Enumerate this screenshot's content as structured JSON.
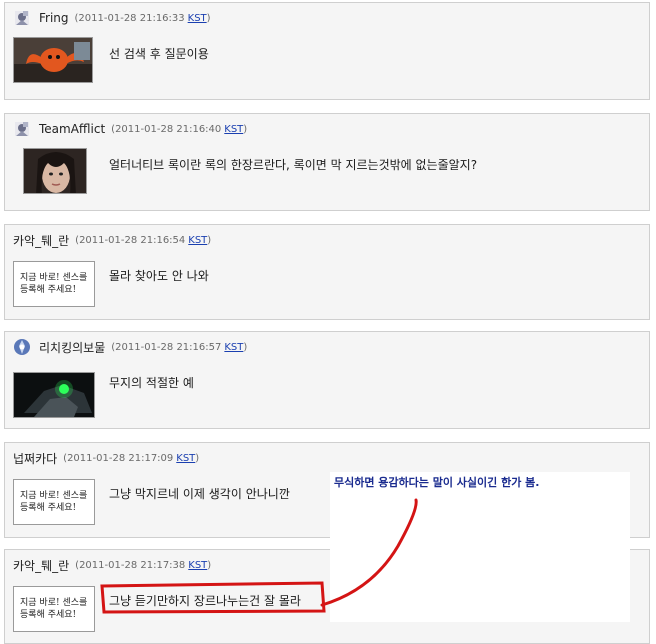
{
  "comments": [
    {
      "name": "Fring",
      "time": "(2011-01-28 21:16:33",
      "tz": "KST",
      "close": ")",
      "text": "선 검색 후 질문이용"
    },
    {
      "name": "TeamAfflict",
      "time": "(2011-01-28 21:16:40",
      "tz": "KST",
      "close": ")",
      "text": "얼터너티브 록이란 록의 한장르란다, 록이면 막 지르는것밖에 없는줄알지?"
    },
    {
      "name": "카악_퉤_란",
      "time": "(2011-01-28 21:16:54",
      "tz": "KST",
      "close": ")",
      "text": "몰라 찾아도 안 나와"
    },
    {
      "name": "리치킹의보물",
      "time": "(2011-01-28 21:16:57",
      "tz": "KST",
      "close": ")",
      "text": "무지의 적절한 예"
    },
    {
      "name": "넙쩌카다",
      "time": "(2011-01-28 21:17:09",
      "tz": "KST",
      "close": ")",
      "text": "그냥 막지르네 이제 생각이 안나니깐"
    },
    {
      "name": "카악_퉤_란",
      "time": "(2011-01-28 21:17:38",
      "tz": "KST",
      "close": ")",
      "text": "그냥 듣기만하지 장르나누는건 잘 몰라"
    }
  ],
  "placeholder_thumb": {
    "line1": "지금 바로! 센스를",
    "line2": "등록해 주세요!"
  },
  "callout": {
    "text": "무식하면 용감하다는 말이 사실이긴 한가 봄."
  },
  "colors": {
    "highlight": "#d41414",
    "callout_text": "#1a2b8f",
    "link": "#1a3fb0"
  }
}
